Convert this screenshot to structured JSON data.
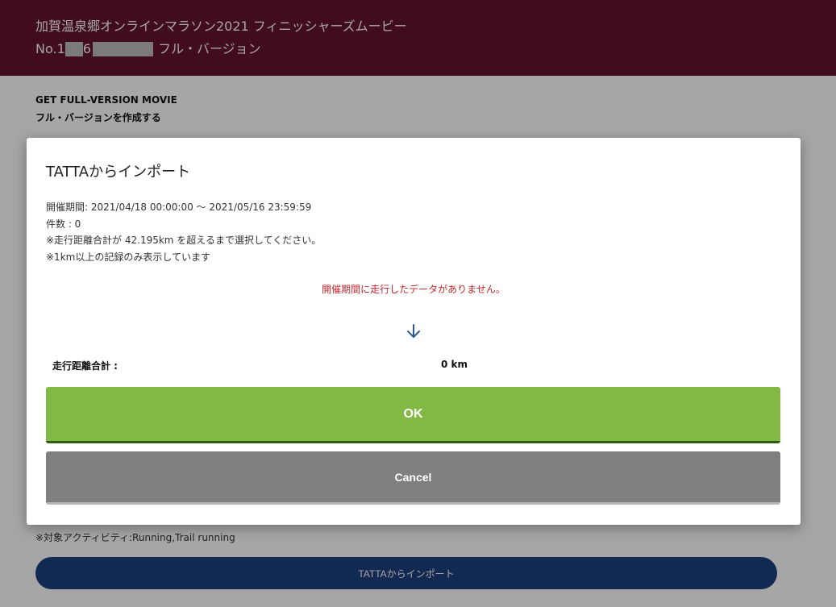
{
  "header": {
    "title": "加賀温泉郷オンラインマラソン2021 フィニッシャーズムービー",
    "number_prefix": "No.1",
    "number_mid": "6",
    "subtitle": "フル・バージョン"
  },
  "page": {
    "heading_en": "GET FULL-VERSION MOVIE",
    "heading_ja": "フル・バージョンを作成する",
    "activity_note": "※対象アクティビティ:Running,Trail running",
    "import_button": "TATTAからインポート"
  },
  "modal": {
    "title": "TATTAからインポート",
    "period": "開催期間: 2021/04/18 00:00:00 〜 2021/05/16 23:59:59",
    "count": "件数 : 0",
    "note_distance": "※走行距離合計が 42.195km を超えるまで選択してください。",
    "note_min": "※1km以上の記録のみ表示しています",
    "no_data_message": "開催期間に走行したデータがありません。",
    "arrow_icon": "arrow-down-icon",
    "total_label": "走行距離合計 :",
    "total_value": "0 km",
    "ok_label": "OK",
    "cancel_label": "Cancel"
  },
  "colors": {
    "header_bg": "#64132a",
    "ok_button": "#82b944",
    "cancel_button": "#7f7f7f",
    "import_button": "#1d3f7f",
    "error_text": "#c0272d",
    "arrow": "#2c5a8f"
  }
}
